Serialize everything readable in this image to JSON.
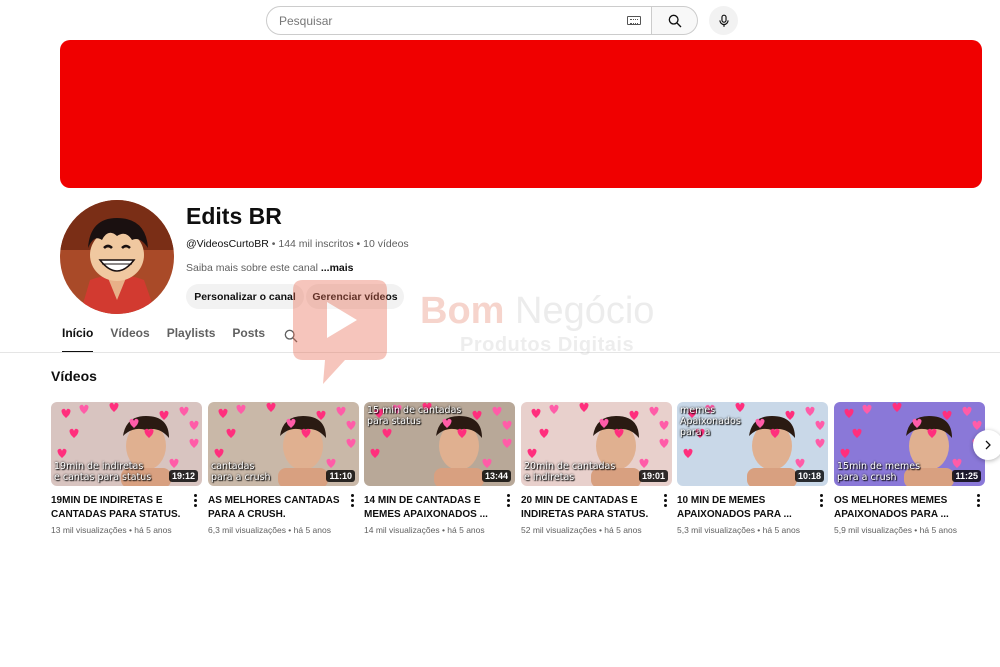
{
  "search": {
    "placeholder": "Pesquisar"
  },
  "banner": {
    "color": "#f00000"
  },
  "channel": {
    "name": "Edits BR",
    "handle": "@VideosCurtoBR",
    "meta": " • 144 mil inscritos • 10 vídeos",
    "about": "Saiba mais sobre este canal ",
    "about_more": "...mais",
    "buttons": {
      "customize": "Personalizar o canal",
      "manage": "Gerenciar vídeos"
    }
  },
  "tabs": [
    {
      "label": "Início",
      "active": true
    },
    {
      "label": "Vídeos",
      "active": false
    },
    {
      "label": "Playlists",
      "active": false
    },
    {
      "label": "Posts",
      "active": false
    }
  ],
  "section_title": "Vídeos",
  "videos": [
    {
      "thumb_text": "19min de indiretas\ne cantas para status",
      "duration": "19:12",
      "title": "19MIN DE INDIRETAS E CANTADAS PARA STATUS.",
      "meta": "13 mil visualizações • há 5 anos",
      "bg": "#d8c4c0"
    },
    {
      "thumb_text": "cantadas\npara a crush",
      "duration": "11:10",
      "title": "AS MELHORES CANTADAS PARA A CRUSH.",
      "meta": "6,3 mil visualizações • há 5 anos",
      "bg": "#c9b8a8"
    },
    {
      "thumb_text": "15 min de cantadas\npara status",
      "duration": "13:44",
      "title": "14 MIN DE CANTADAS E MEMES APAIXONADOS ...",
      "meta": "14 mil visualizações • há 5 anos",
      "bg": "#b8a898"
    },
    {
      "thumb_text": "20min de cantadas\ne indiretas",
      "duration": "19:01",
      "title": "20 MIN DE CANTADAS E INDIRETAS PARA STATUS.",
      "meta": "52 mil visualizações • há 5 anos",
      "bg": "#e8d0cc"
    },
    {
      "thumb_text": "memes\nApaixonados\npara a",
      "duration": "10:18",
      "title": "10 MIN DE MEMES APAIXONADOS PARA ...",
      "meta": "5,3 mil visualizações • há 5 anos",
      "bg": "#c9d8e8"
    },
    {
      "thumb_text": "15min de memes\npara a crush",
      "duration": "11:25",
      "title": "OS MELHORES MEMES APAIXONADOS PARA ...",
      "meta": "5,9 mil visualizações • há 5 anos",
      "bg": "#8a78d8"
    }
  ],
  "watermark": {
    "brand_1": "Bom ",
    "brand_2": "Negócio",
    "sub": "Produtos Digitais"
  },
  "icons": {
    "search": "search-icon",
    "mic": "microphone-icon",
    "keyboard": "keyboard-icon",
    "next": "chevron-right-icon",
    "menu": "more-vert-icon"
  }
}
